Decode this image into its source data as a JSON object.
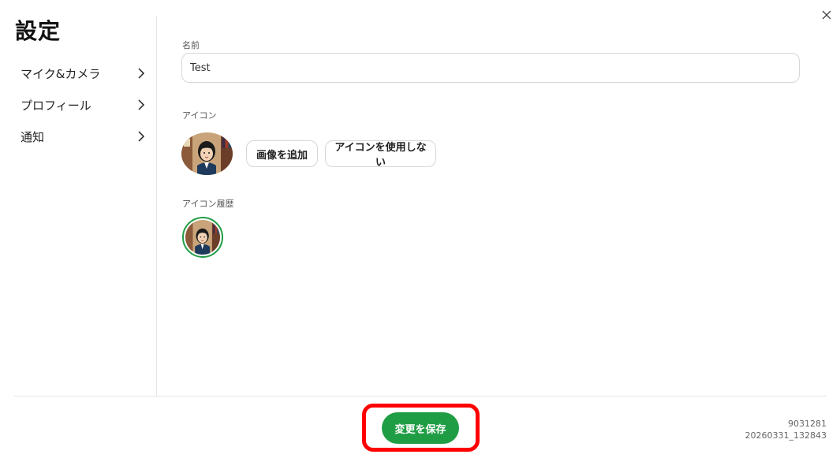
{
  "page": {
    "title": "設定"
  },
  "sidebar": {
    "items": [
      {
        "label": "マイク&カメラ"
      },
      {
        "label": "プロフィール"
      },
      {
        "label": "通知"
      }
    ]
  },
  "profile": {
    "name_label": "名前",
    "name_value": "Test",
    "icon_label": "アイコン",
    "add_image_label": "画像を追加",
    "no_icon_label": "アイコンを使用しない",
    "history_label": "アイコン履歴"
  },
  "footer": {
    "save_label": "変更を保存",
    "version_line1": "9031281",
    "version_line2": "20260331_132843"
  },
  "colors": {
    "accent": "#1f9d45",
    "highlight": "#ff0000"
  }
}
